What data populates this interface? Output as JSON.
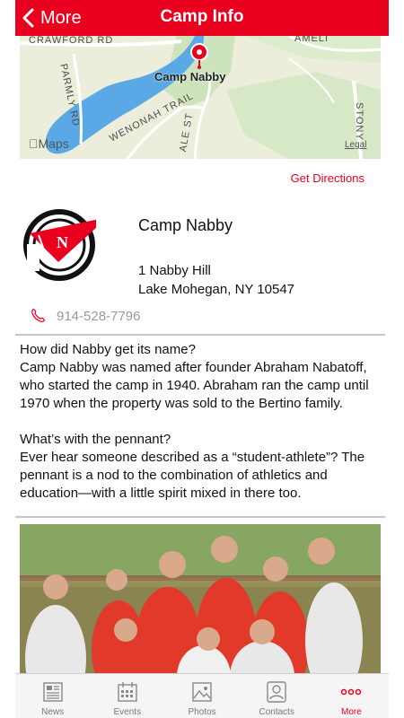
{
  "header": {
    "back_label": "More",
    "title": "Camp Info"
  },
  "map": {
    "pin_label": "Camp Nabby",
    "roads": [
      "CRAWFORD RD",
      "PARMLY RD",
      "WENONAH TRAIL",
      "ALE ST",
      "AMELI",
      "STONY"
    ],
    "attribution": "Maps",
    "legal": "Legal"
  },
  "directions_label": "Get Directions",
  "camp": {
    "name": "Camp Nabby",
    "address_line1": "1 Nabby Hill",
    "address_line2": "Lake Mohegan, NY 10547",
    "phone": "914-528-7796"
  },
  "about": {
    "q1": "How did Nabby get its name?",
    "a1": "Camp Nabby was named after founder Abraham Nabatoff, who started the camp in 1940. Abraham ran the camp until 1970 when the property was sold to the Bertino family.",
    "q2": "What’s with the pennant?",
    "a2": "Ever hear someone described as a “student-athlete”? The pennant is a nod to the combination of athletics and education—with a little spirit mixed in there too."
  },
  "tabs": [
    {
      "label": "News",
      "icon": "news-icon"
    },
    {
      "label": "Events",
      "icon": "calendar-icon"
    },
    {
      "label": "Photos",
      "icon": "photos-icon"
    },
    {
      "label": "Contacts",
      "icon": "contacts-icon"
    },
    {
      "label": "More",
      "icon": "more-icon",
      "active": true
    }
  ],
  "colors": {
    "accent": "#e8001e",
    "water": "#5aa9e6",
    "park": "#b7d9a8"
  }
}
